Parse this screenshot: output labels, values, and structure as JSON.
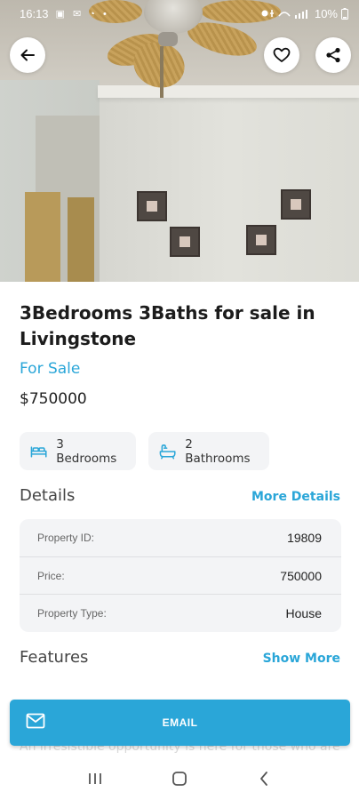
{
  "status_bar": {
    "time": "16:13",
    "left_icons": "▣ ✉ ◔ •",
    "battery": "10%"
  },
  "hero": {
    "back_icon": "arrow-left-icon",
    "favorite_icon": "heart-icon",
    "share_icon": "share-icon"
  },
  "listing": {
    "title": "3Bedrooms 3Baths for sale in Livingstone",
    "status": "For Sale",
    "price": "$750000",
    "bedrooms": "3 Bedrooms",
    "bathrooms": "2 Bathrooms"
  },
  "details": {
    "heading": "Details",
    "more_link": "More Details",
    "rows": [
      {
        "label": "Property ID:",
        "value": "19809"
      },
      {
        "label": "Price:",
        "value": "750000"
      },
      {
        "label": "Property Type:",
        "value": "House"
      }
    ]
  },
  "features": {
    "heading": "Features",
    "more_link": "Show More"
  },
  "description_peek": "An irresistible opportunity is here for those who are",
  "email_button": {
    "label": "EMAIL",
    "icon": "mail-icon"
  },
  "colors": {
    "accent": "#2aa6d8",
    "chip_bg": "#f3f4f6"
  }
}
